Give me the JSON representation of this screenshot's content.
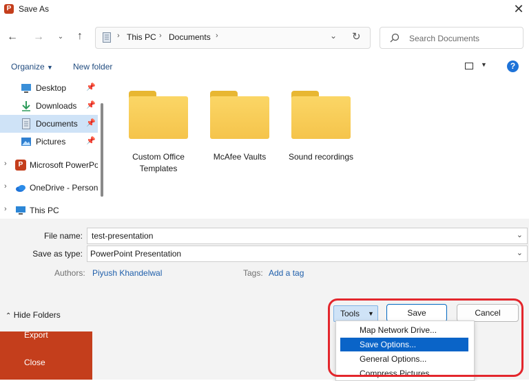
{
  "window": {
    "title": "Save As",
    "close_glyph": "✕",
    "app_icon_letter": "P"
  },
  "nav": {
    "path": [
      "This PC",
      "Documents"
    ],
    "search_placeholder": "Search Documents"
  },
  "commandbar": {
    "organize_label": "Organize",
    "new_folder_label": "New folder",
    "help_glyph": "?"
  },
  "quick_access": [
    {
      "label": "Desktop",
      "icon": "desktop-icon"
    },
    {
      "label": "Downloads",
      "icon": "download-icon"
    },
    {
      "label": "Documents",
      "icon": "documents-icon",
      "selected": true
    },
    {
      "label": "Pictures",
      "icon": "pictures-icon"
    }
  ],
  "tree": [
    {
      "label": "Microsoft PowerPo",
      "icon": "powerpoint-icon"
    },
    {
      "label": "OneDrive - Person",
      "icon": "onedrive-icon"
    },
    {
      "label": "This PC",
      "icon": "computer-icon"
    }
  ],
  "folders": [
    {
      "line1": "Custom Office",
      "line2": "Templates"
    },
    {
      "line1": "McAfee Vaults",
      "line2": ""
    },
    {
      "line1": "Sound recordings",
      "line2": ""
    }
  ],
  "form": {
    "file_name_label": "File name:",
    "file_name_value": "test-presentation",
    "save_type_label": "Save as type:",
    "save_type_value": "PowerPoint Presentation",
    "authors_label": "Authors:",
    "authors_value": "Piyush Khandelwal",
    "tags_label": "Tags:",
    "tags_value": "Add a tag"
  },
  "footer": {
    "hide_folders_label": "Hide Folders",
    "tools_label": "Tools",
    "save_label": "Save",
    "cancel_label": "Cancel"
  },
  "tools_menu": [
    {
      "label": "Map Network Drive..."
    },
    {
      "label": "Save Options...",
      "highlighted": true
    },
    {
      "label": "General Options..."
    },
    {
      "label": "Compress Pictures..."
    }
  ],
  "backstage": {
    "items": [
      "Export",
      "Close"
    ]
  },
  "colors": {
    "accent": "#0a64c8",
    "backstage": "#c43e1c",
    "annotation_ring": "#e3262c",
    "selection": "#cfe3f7"
  }
}
